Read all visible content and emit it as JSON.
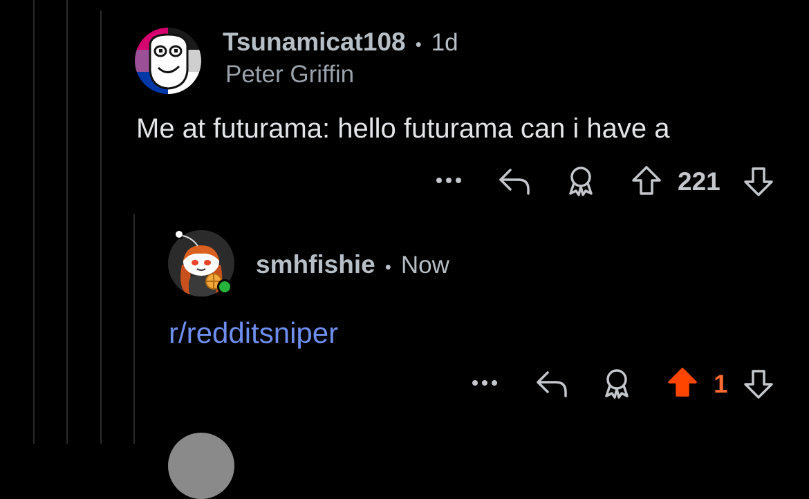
{
  "comments": [
    {
      "username": "Tsunamicat108",
      "separator": "•",
      "age": "1d",
      "flair": "Peter Griffin",
      "body": "Me at futurama: hello futurama can i have a",
      "votes": "221",
      "upvoted": false
    },
    {
      "username": "smhfishie",
      "separator": "•",
      "age": "Now",
      "body_link": "r/redditsniper",
      "votes": "1",
      "upvoted": true,
      "online": true
    }
  ],
  "icons": {
    "more": "more-options-icon",
    "reply": "reply-icon",
    "award": "award-icon",
    "upvote": "upvote-arrow-icon",
    "downvote": "downvote-arrow-icon"
  },
  "colors": {
    "background": "#000000",
    "username": "#b7bfc6",
    "link": "#6f8ff0",
    "upvoted": "#ff4500",
    "online": "#26b33c"
  }
}
